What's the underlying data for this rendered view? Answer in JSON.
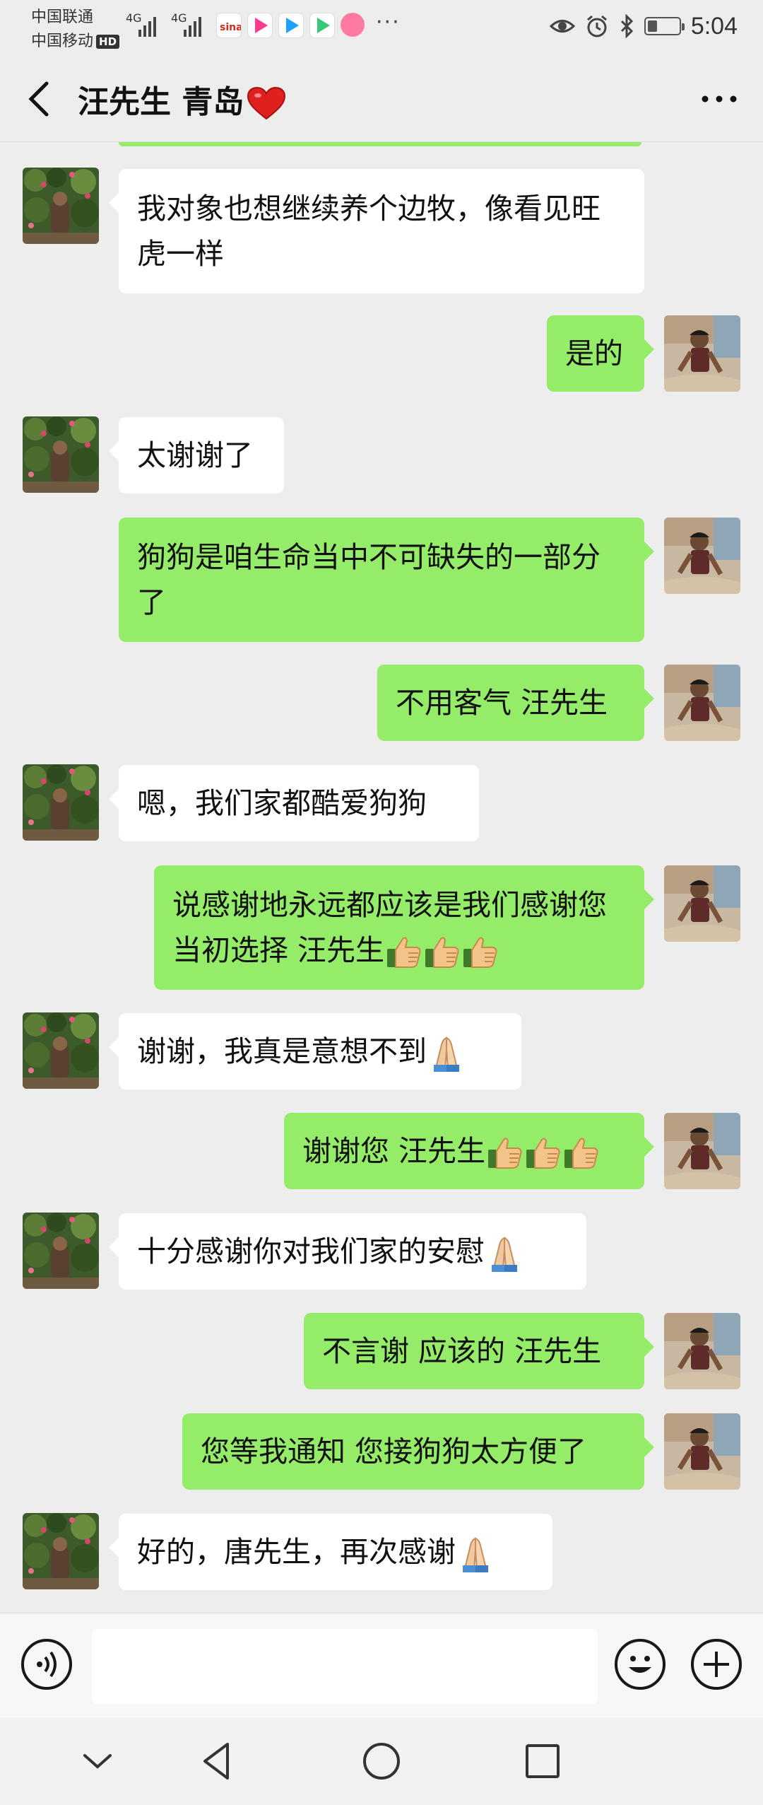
{
  "status_bar": {
    "carrier_1": "中国联通",
    "carrier_2": "中国移动",
    "hd_badge": "HD",
    "network_1": "4G",
    "network_2": "4G",
    "app_icons": [
      "sina-weibo-icon",
      "youku-icon",
      "youku-icon",
      "video-play-icon",
      "pink-app-icon"
    ],
    "more": "···",
    "time": "5:04",
    "battery_level": 0.3
  },
  "header": {
    "title": "汪先生 青岛"
  },
  "messages": [
    {
      "side": "in",
      "text": "我对象也想继续养个边牧，像看见旺虎一样"
    },
    {
      "side": "out",
      "text": "是的"
    },
    {
      "side": "in",
      "text": "太谢谢了"
    },
    {
      "side": "out",
      "text": "狗狗是咱生命当中不可缺失的一部分了"
    },
    {
      "side": "out",
      "text": "不用客气 汪先生"
    },
    {
      "side": "in",
      "text": "嗯，我们家都酷爱狗狗"
    },
    {
      "side": "out",
      "text": "说感谢地永远都应该是我们感谢您当初选择 汪先生",
      "emoji": [
        "thumbs-up",
        "thumbs-up",
        "thumbs-up"
      ]
    },
    {
      "side": "in",
      "text": "谢谢，我真是意想不到",
      "emoji": [
        "folded-hands"
      ]
    },
    {
      "side": "out",
      "text": "谢谢您 汪先生",
      "emoji": [
        "thumbs-up",
        "thumbs-up",
        "thumbs-up"
      ]
    },
    {
      "side": "in",
      "text": "十分感谢你对我们家的安慰",
      "emoji": [
        "folded-hands"
      ]
    },
    {
      "side": "out",
      "text": "不言谢 应该的 汪先生"
    },
    {
      "side": "out",
      "text": "您等我通知 您接狗狗太方便了"
    },
    {
      "side": "in",
      "text": "好的，唐先生，再次感谢",
      "emoji": [
        "folded-hands"
      ]
    }
  ],
  "input_bar": {
    "voice_icon": "voice-icon",
    "emoji_icon": "emoji-icon",
    "plus_icon": "plus-icon",
    "text_value": ""
  },
  "nav_bar": {
    "icons": [
      "chevron-down-icon",
      "back-triangle-icon",
      "home-circle-icon",
      "recents-square-icon"
    ]
  },
  "colors": {
    "background": "#ededed",
    "outgoing_bubble": "#95ec69",
    "incoming_bubble": "#ffffff"
  }
}
